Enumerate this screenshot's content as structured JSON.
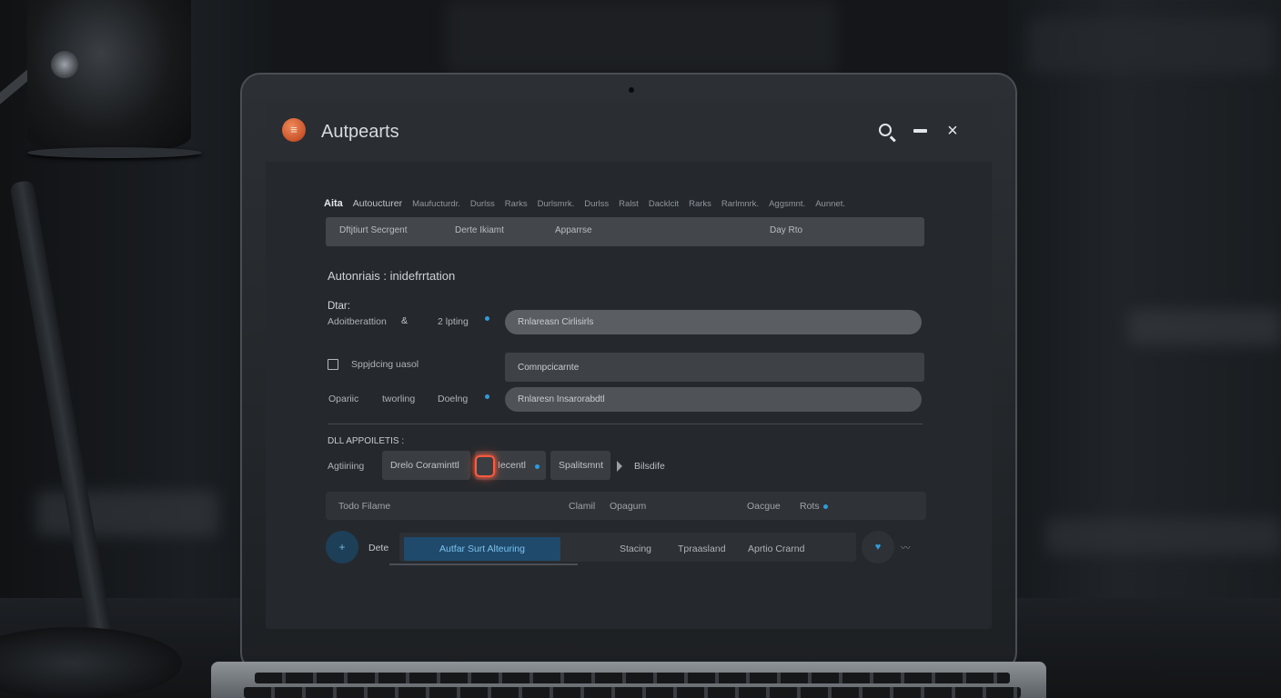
{
  "window": {
    "title": "Autpearts",
    "controls": [
      "search",
      "minimize",
      "close"
    ],
    "close_glyph": "×"
  },
  "menu": {
    "brand": "Aita",
    "items": [
      "Autoucturer",
      "Maufucturdr.",
      "Durlss",
      "Rarks",
      "Durlsmrk.",
      "Durlss",
      "Ralst",
      "Dacklcit",
      "Rarks",
      "Rarlmnrk.",
      "Aggsmnt.",
      "Aunnet."
    ]
  },
  "tabs": [
    "Dftjtiurt Secrgent",
    "Derte Ikiamt",
    "Apparrse",
    "Day Rto"
  ],
  "section": {
    "title": "Autonriais : inidefrrtation",
    "label_dtar": "Dtar:",
    "row1_left": "Adoitberattion",
    "row1_amp": "&",
    "row1_mid": "2 lpting",
    "row1_field": "Rnlareasn Cirlisirls",
    "row2_check_label": "Sppjdcing uasol",
    "row2_field": "Comnpcicarnte",
    "row3_a": "Opariic",
    "row3_b": "tworling",
    "row3_c": "Doelng",
    "row3_field": "Rnlaresn Insarorabdtl"
  },
  "actions": {
    "heading": "DLL APPOILETIS :",
    "label": "Agtiiriing",
    "chip1": "Drelo Coraminttl",
    "chip2": "Iecentl",
    "chip3": "Spalitsmnt",
    "after_play": "Bilsdife"
  },
  "table": {
    "headers": [
      "Todo Filame",
      "Clamil",
      "Opagum",
      "Oacgue",
      "Rots"
    ],
    "row": {
      "add_glyph": "+",
      "label": "Dete",
      "active": "Autfar  Surt Alteuring",
      "cells": [
        "Stacing",
        "Tpraasland",
        "Aprtio Crarnd"
      ],
      "heart_glyph": "♥",
      "trail_glyph": "〰"
    }
  },
  "colors": {
    "accent_blue": "#2f9bdc",
    "highlight_red": "#ff5a3c",
    "app_icon_orange": "#d9612f"
  },
  "icons": [
    "menu-icon",
    "search-icon",
    "minimize-icon",
    "close-icon",
    "checkbox-icon",
    "play-icon",
    "add-icon",
    "heart-icon"
  ]
}
